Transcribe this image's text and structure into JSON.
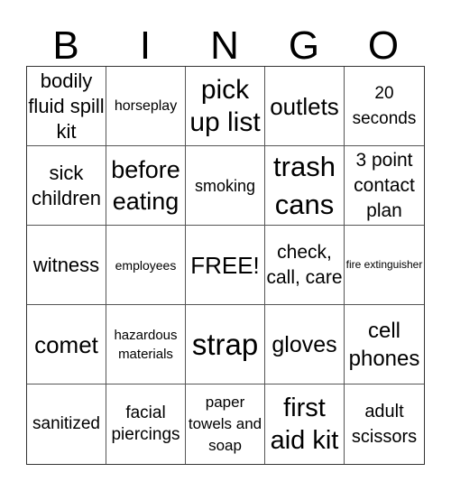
{
  "header": {
    "letters": [
      "B",
      "I",
      "N",
      "G",
      "O"
    ]
  },
  "cells": [
    {
      "text": "bodily fluid spill kit",
      "size": 22,
      "lh": 28
    },
    {
      "text": "horseplay",
      "size": 16,
      "lh": 20
    },
    {
      "text": "pick up list",
      "size": 30,
      "lh": 36
    },
    {
      "text": "outlets",
      "size": 26,
      "lh": 30
    },
    {
      "text": "20 seconds",
      "size": 19,
      "lh": 28
    },
    {
      "text": "sick children",
      "size": 22,
      "lh": 28
    },
    {
      "text": "before eating",
      "size": 27,
      "lh": 35
    },
    {
      "text": "smoking",
      "size": 18,
      "lh": 22
    },
    {
      "text": "trash cans",
      "size": 31,
      "lh": 42
    },
    {
      "text": "3 point contact plan",
      "size": 21,
      "lh": 28
    },
    {
      "text": "witness",
      "size": 22,
      "lh": 26
    },
    {
      "text": "employees",
      "size": 14,
      "lh": 18
    },
    {
      "text": "FREE!",
      "size": 26,
      "lh": 30
    },
    {
      "text": "check, call, care",
      "size": 21,
      "lh": 28
    },
    {
      "text": "fire extinguisher",
      "size": 12,
      "lh": 17
    },
    {
      "text": "comet",
      "size": 26,
      "lh": 30
    },
    {
      "text": "hazardous materials",
      "size": 15,
      "lh": 21
    },
    {
      "text": "strap",
      "size": 33,
      "lh": 38
    },
    {
      "text": "gloves",
      "size": 25,
      "lh": 30
    },
    {
      "text": "cell phones",
      "size": 24,
      "lh": 31
    },
    {
      "text": "sanitized",
      "size": 19,
      "lh": 24
    },
    {
      "text": "facial piercings",
      "size": 19,
      "lh": 24
    },
    {
      "text": "paper towels and soap",
      "size": 17,
      "lh": 24
    },
    {
      "text": "first aid kit",
      "size": 29,
      "lh": 36
    },
    {
      "text": "adult scissors",
      "size": 20,
      "lh": 28
    }
  ]
}
